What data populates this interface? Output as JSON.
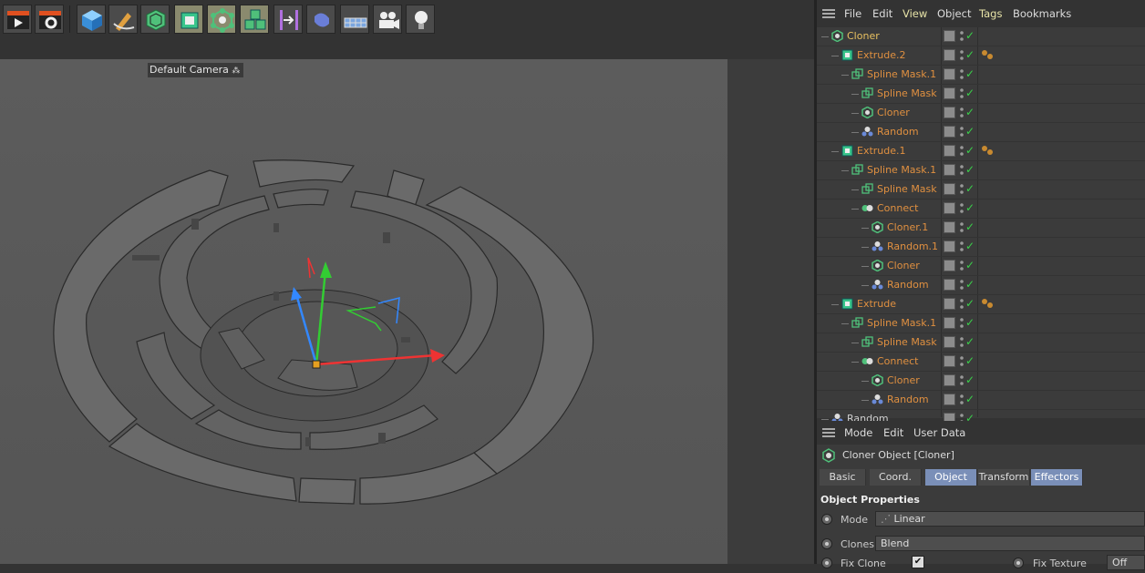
{
  "viewport": {
    "camera_label": "Default Camera"
  },
  "toolbar": {
    "buttons": [
      "render-view-icon",
      "render-settings-icon",
      "cube-icon",
      "pen-icon",
      "subdivision-icon",
      "extrude-icon",
      "cloner-icon",
      "array-icon",
      "field-icon",
      "deformer-icon",
      "floor-icon",
      "camera-icon",
      "light-icon"
    ]
  },
  "object_manager": {
    "menu": [
      "File",
      "Edit",
      "View",
      "Object",
      "Tags",
      "Bookmarks"
    ],
    "rows": [
      {
        "label": "Cloner",
        "depth": 0,
        "icon": "cloner",
        "color": "#e8c060",
        "tag": false
      },
      {
        "label": "Extrude.2",
        "depth": 1,
        "icon": "extrude",
        "color": "#e09040",
        "tag": true
      },
      {
        "label": "Spline Mask.1",
        "depth": 2,
        "icon": "splinemask",
        "color": "#e09040",
        "tag": false
      },
      {
        "label": "Spline Mask",
        "depth": 3,
        "icon": "splinemask",
        "color": "#e09040",
        "tag": false
      },
      {
        "label": "Cloner",
        "depth": 3,
        "icon": "cloner",
        "color": "#e09040",
        "tag": false
      },
      {
        "label": "Random",
        "depth": 3,
        "icon": "random",
        "color": "#e09040",
        "tag": false
      },
      {
        "label": "Extrude.1",
        "depth": 1,
        "icon": "extrude",
        "color": "#e09040",
        "tag": true
      },
      {
        "label": "Spline Mask.1",
        "depth": 2,
        "icon": "splinemask",
        "color": "#e09040",
        "tag": false
      },
      {
        "label": "Spline Mask",
        "depth": 3,
        "icon": "splinemask",
        "color": "#e09040",
        "tag": false
      },
      {
        "label": "Connect",
        "depth": 3,
        "icon": "connect",
        "color": "#e09040",
        "tag": false
      },
      {
        "label": "Cloner.1",
        "depth": 4,
        "icon": "cloner",
        "color": "#e09040",
        "tag": false
      },
      {
        "label": "Random.1",
        "depth": 4,
        "icon": "random",
        "color": "#e09040",
        "tag": false
      },
      {
        "label": "Cloner",
        "depth": 4,
        "icon": "cloner",
        "color": "#e09040",
        "tag": false
      },
      {
        "label": "Random",
        "depth": 4,
        "icon": "random",
        "color": "#e09040",
        "tag": false
      },
      {
        "label": "Extrude",
        "depth": 1,
        "icon": "extrude",
        "color": "#e09040",
        "tag": true
      },
      {
        "label": "Spline Mask.1",
        "depth": 2,
        "icon": "splinemask",
        "color": "#e09040",
        "tag": false
      },
      {
        "label": "Spline Mask",
        "depth": 3,
        "icon": "splinemask",
        "color": "#e09040",
        "tag": false
      },
      {
        "label": "Connect",
        "depth": 3,
        "icon": "connect",
        "color": "#e09040",
        "tag": false
      },
      {
        "label": "Cloner",
        "depth": 4,
        "icon": "cloner",
        "color": "#e09040",
        "tag": false
      },
      {
        "label": "Random",
        "depth": 4,
        "icon": "random",
        "color": "#e09040",
        "tag": false
      },
      {
        "label": "Random",
        "depth": 0,
        "icon": "random",
        "color": "#d0d0d0",
        "tag": false
      }
    ]
  },
  "attribute_manager": {
    "menu": [
      "Mode",
      "Edit",
      "User Data"
    ],
    "title": "Cloner Object [Cloner]",
    "tabs": [
      {
        "label": "Basic",
        "active": false
      },
      {
        "label": "Coord.",
        "active": false
      },
      {
        "label": "Object",
        "active": true
      },
      {
        "label": "Transform",
        "active": false
      },
      {
        "label": "Effectors",
        "active": true
      }
    ],
    "section": "Object Properties",
    "mode_label": "Mode",
    "mode_value": "Linear",
    "clones_label": "Clones",
    "clones_value": "Blend",
    "fix_clone_label": "Fix Clone",
    "fix_texture_label": "Fix Texture",
    "fix_texture_value": "Off"
  }
}
